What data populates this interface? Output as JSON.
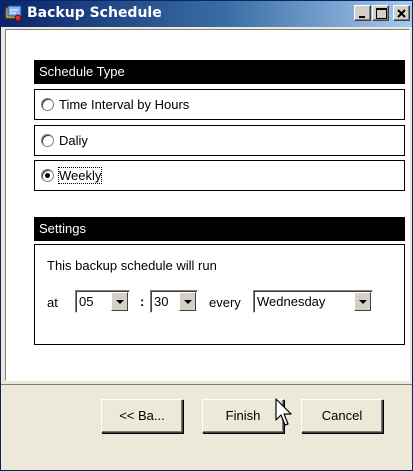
{
  "window": {
    "title": "Backup Schedule",
    "icon": "backup-app-icon",
    "controls": [
      "minimize-icon",
      "maximize-icon",
      "close-icon"
    ]
  },
  "schedule_type": {
    "header": "Schedule Type",
    "options": [
      {
        "label": "Time Interval by Hours",
        "checked": false
      },
      {
        "label": "Daliy",
        "checked": false
      },
      {
        "label": "Weekly",
        "checked": true
      }
    ]
  },
  "settings": {
    "header": "Settings",
    "description": "This backup schedule will run",
    "at_label": "at",
    "hour": "05",
    "separator": ":",
    "minute": "30",
    "every_label": "every",
    "day": "Wednesday"
  },
  "buttons": {
    "back": "<< Ba...",
    "finish": "Finish",
    "cancel": "Cancel"
  }
}
